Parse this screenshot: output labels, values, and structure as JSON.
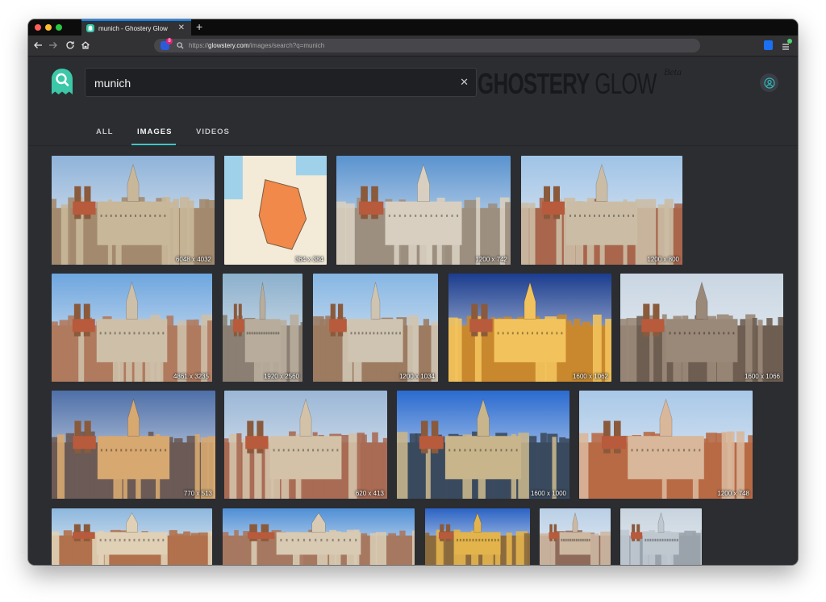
{
  "browser": {
    "tab_title": "munich - Ghostery Glow",
    "tab_close": "✕",
    "new_tab": "+",
    "url_prefix": "https://",
    "url_domain": "glowstery.com",
    "url_path": "/images/search?q=munich",
    "tracker_count": "8"
  },
  "header": {
    "search_value": "munich",
    "clear_label": "✕",
    "wordmark_bold": "GHOSTERY",
    "wordmark_light": "GLOW",
    "beta_label": "Beta"
  },
  "search_tabs": [
    {
      "label": "ALL",
      "active": false
    },
    {
      "label": "IMAGES",
      "active": true
    },
    {
      "label": "VIDEOS",
      "active": false
    }
  ],
  "results": [
    {
      "dims": "6048 x 4032",
      "sky": "#8fb3d9",
      "ground": "#a38a6e",
      "accent": "#c9b79a"
    },
    {
      "dims": "364 x 384",
      "sky": "#f3ead7",
      "ground": "#f2f0e4",
      "accent": "#f0894a",
      "map": true
    },
    {
      "dims": "1200 x 742",
      "sky": "#5a93cf",
      "ground": "#9c8f80",
      "accent": "#d8cfc0"
    },
    {
      "dims": "1200 x 800",
      "sky": "#9fc3e6",
      "ground": "#a8664d",
      "accent": "#cbbda5"
    },
    {
      "dims": "4861 x 3235",
      "sky": "#6ea6df",
      "ground": "#b07a5e",
      "accent": "#cdbfa8"
    },
    {
      "dims": "1920 x 2560",
      "sky": "#8cb0cc",
      "ground": "#8a7f72",
      "accent": "#b8ad9c"
    },
    {
      "dims": "1200 x 1034",
      "sky": "#86b6e3",
      "ground": "#9c7b62",
      "accent": "#cfc4b1"
    },
    {
      "dims": "1600 x 1062",
      "sky": "#1b3d8f",
      "ground": "#c9882e",
      "accent": "#f2c35d"
    },
    {
      "dims": "1600 x 1066",
      "sky": "#c9d6e2",
      "ground": "#6e5e52",
      "accent": "#9a8878"
    },
    {
      "dims": "770 x 513",
      "sky": "#4e6fa8",
      "ground": "#6b5a55",
      "accent": "#d7a870"
    },
    {
      "dims": "620 x 413",
      "sky": "#9bb7d6",
      "ground": "#a96b54",
      "accent": "#d3c2a8"
    },
    {
      "dims": "1600 x 1000",
      "sky": "#2a6bd0",
      "ground": "#3b4a5e",
      "accent": "#c8b58c"
    },
    {
      "dims": "1200 x 748",
      "sky": "#a9c8e8",
      "ground": "#b86a45",
      "accent": "#d9b79a"
    },
    {
      "dims": "",
      "sky": "#8db7dd",
      "ground": "#b1714d",
      "accent": "#e0d0b6"
    },
    {
      "dims": "",
      "sky": "#4f8fd6",
      "ground": "#a77861",
      "accent": "#d8cab3"
    },
    {
      "dims": "",
      "sky": "#2b63c4",
      "ground": "#8b6a3e",
      "accent": "#e3b44c"
    },
    {
      "dims": "",
      "sky": "#b9cfe6",
      "ground": "#8f6a5b",
      "accent": "#cdb8a2"
    },
    {
      "dims": "",
      "sky": "#c7d3de",
      "ground": "#9aa3ab",
      "accent": "#bfc7cf"
    }
  ]
}
